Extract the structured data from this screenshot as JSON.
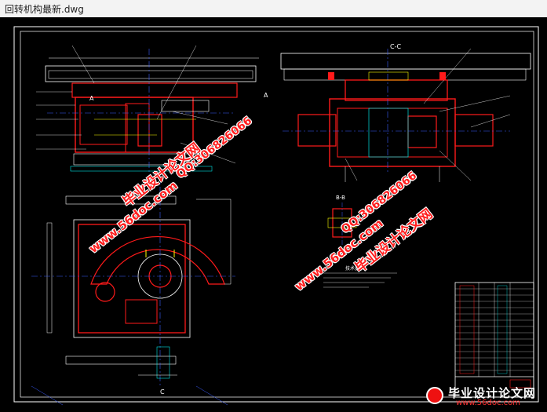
{
  "window": {
    "title": "回转机构最新.dwg"
  },
  "drawing": {
    "section_label": "C-C",
    "view_b_label": "B-B",
    "marker_a": "A",
    "marker_c": "C",
    "tech_req_title": "技术要求"
  },
  "watermarks": {
    "site_url": "www.56doc.com",
    "brand": "毕业设计论文网",
    "qq": "QQ:306826066"
  },
  "logo": {
    "brand": "毕业设计论文网",
    "url": "www.56doc.com"
  },
  "colors": {
    "background": "#000000",
    "primary_line": "#ff1a1a",
    "secondary_line": "#ffffff",
    "center_line": "#3a5cff",
    "highlight": "#00e5e5",
    "accent": "#ffff00"
  }
}
